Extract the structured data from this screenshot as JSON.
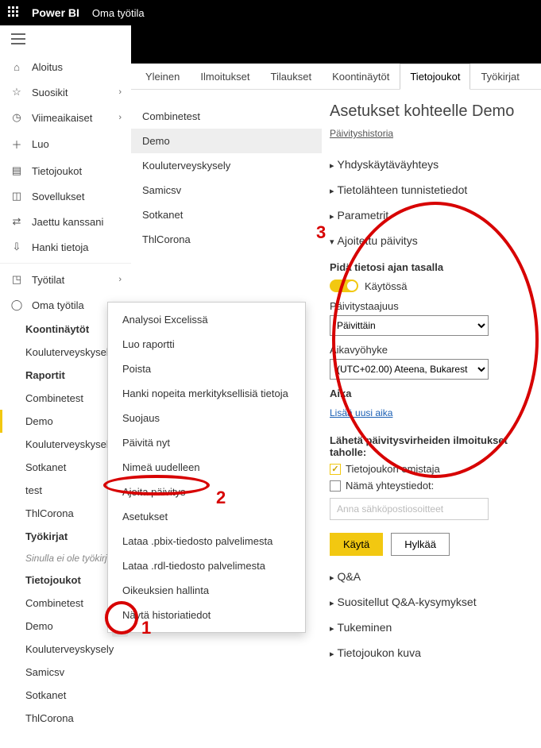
{
  "topbar": {
    "brand": "Power BI",
    "workspace": "Oma työtila"
  },
  "sidebar": {
    "home": "Aloitus",
    "favorites": "Suosikit",
    "recent": "Viimeaikaiset",
    "create": "Luo",
    "datasets": "Tietojoukot",
    "apps": "Sovellukset",
    "shared": "Jaettu kanssani",
    "getdata": "Hanki tietoja",
    "workspaces": "Työtilat",
    "myworkspace": "Oma työtila",
    "tree": {
      "dashboards": "Koontinäytöt",
      "dash_items": [
        "Kouluterveyskysely.pbix"
      ],
      "reports": "Raportit",
      "rep_items": [
        "Combinetest",
        "Demo",
        "Kouluterveyskysely",
        "Sotkanet",
        "test",
        "ThlCorona"
      ],
      "workbooks": "Työkirjat",
      "workbooks_empty": "Sinulla ei ole työkirjoja",
      "datasets": "Tietojoukot",
      "ds_items": [
        "Combinetest",
        "Demo",
        "Kouluterveyskysely",
        "Samicsv",
        "Sotkanet",
        "ThlCorona"
      ]
    }
  },
  "contextmenu": [
    "Analysoi Excelissä",
    "Luo raportti",
    "Poista",
    "Hanki nopeita merkityksellisiä tietoja",
    "Suojaus",
    "Päivitä nyt",
    "Nimeä uudelleen",
    "Ajoita päivitys",
    "Asetukset",
    "Lataa .pbix-tiedosto palvelimesta",
    "Lataa .rdl-tiedosto palvelimesta",
    "Oikeuksien hallinta",
    "Näytä historiatiedot"
  ],
  "tabs": [
    "Yleinen",
    "Ilmoitukset",
    "Tilaukset",
    "Koontinäytöt",
    "Tietojoukot",
    "Työkirjat"
  ],
  "active_tab": "Tietojoukot",
  "dataset_list": [
    "Combinetest",
    "Demo",
    "Kouluterveyskysely",
    "Samicsv",
    "Sotkanet",
    "ThlCorona"
  ],
  "selected_dataset": "Demo",
  "settings": {
    "title": "Asetukset kohteelle Demo",
    "history_link": "Päivityshistoria",
    "sec_gateway": "Yhdyskäytäväyhteys",
    "sec_creds": "Tietolähteen tunnistetiedot",
    "sec_params": "Parametrit",
    "sec_sched": "Ajoitettu päivitys",
    "keep_title": "Pidä tietosi ajan tasalla",
    "toggle_on": "Käytössä",
    "freq_label": "Päivitystaajuus",
    "freq_value": "Päivittäin",
    "tz_label": "Aikavyöhyke",
    "tz_value": "(UTC+02.00) Ateena, Bukarest",
    "time_label": "Aika",
    "add_time": "Lisää uusi aika",
    "notify_label": "Lähetä päivitysvirheiden ilmoitukset taholle:",
    "notify_owner": "Tietojoukon omistaja",
    "notify_emails": "Nämä yhteystiedot:",
    "email_placeholder": "Anna sähköpostiosoitteet",
    "apply": "Käytä",
    "discard": "Hylkää",
    "sec_qa": "Q&A",
    "sec_featured": "Suositellut Q&A-kysymykset",
    "sec_endorse": "Tukeminen",
    "sec_image": "Tietojoukon kuva"
  },
  "annotations": {
    "one": "1",
    "two": "2",
    "three": "3"
  }
}
